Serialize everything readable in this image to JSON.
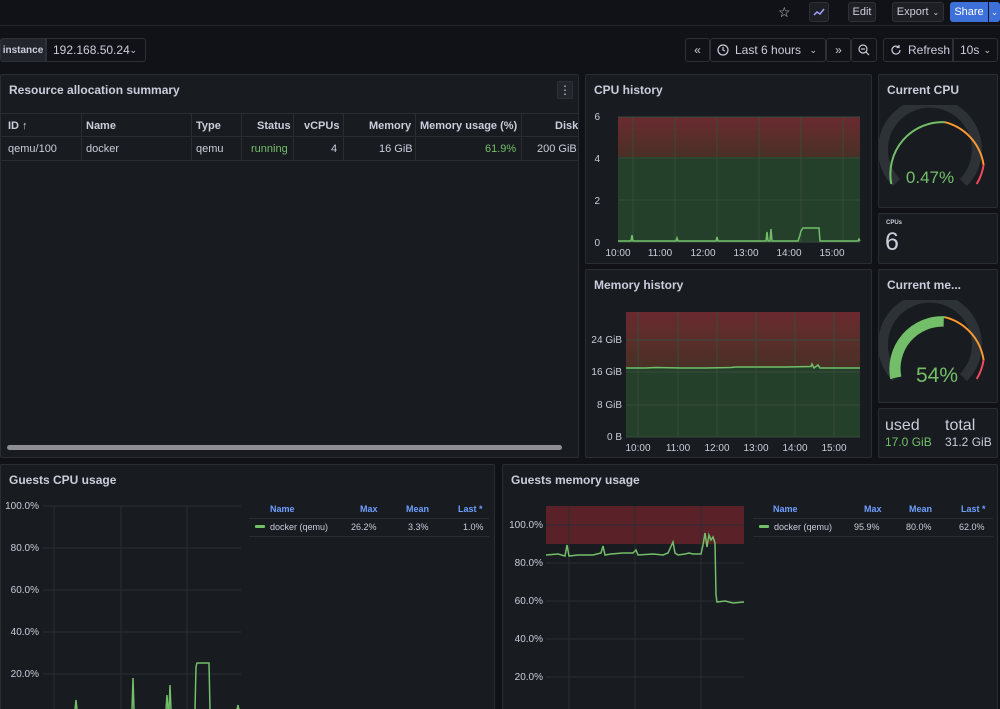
{
  "toolbar": {
    "edit": "Edit",
    "export": "Export",
    "share": "Share"
  },
  "controls": {
    "variable_label": "instance",
    "variable_value": "192.168.50.24",
    "time_range": "Last 6 hours",
    "refresh": "Refresh",
    "refresh_interval": "10s"
  },
  "resource_panel": {
    "title": "Resource allocation summary",
    "columns": [
      "ID ↑",
      "Name",
      "Type",
      "Status",
      "vCPUs",
      "Memory",
      "Memory usage (%)",
      "Disk"
    ],
    "rows": [
      {
        "id": "qemu/100",
        "name": "docker",
        "type": "qemu",
        "status": "running",
        "vcpus": "4",
        "memory": "16 GiB",
        "mem_usage": "61.9%",
        "disk": "200 GiB"
      }
    ]
  },
  "cpu_history": {
    "title": "CPU history",
    "yticks": [
      "6",
      "4",
      "2",
      "0"
    ],
    "xticks": [
      "10:00",
      "11:00",
      "12:00",
      "13:00",
      "14:00",
      "15:00"
    ]
  },
  "current_cpu": {
    "title": "Current CPU",
    "value": "0.47%",
    "fraction": 0.0047
  },
  "cpus_stat": {
    "label": "CPUs",
    "value": "6"
  },
  "memory_history": {
    "title": "Memory history",
    "yticks": [
      "24 GiB",
      "16 GiB",
      "8 GiB",
      "0 B"
    ],
    "xticks": [
      "10:00",
      "11:00",
      "12:00",
      "13:00",
      "14:00",
      "15:00"
    ]
  },
  "current_memory": {
    "title": "Current me...",
    "value": "54%",
    "fraction": 0.54
  },
  "memory_stat": {
    "used_label": "used",
    "used_value": "17.0 GiB",
    "total_label": "total",
    "total_value": "31.2 GiB"
  },
  "guests_cpu": {
    "title": "Guests CPU usage",
    "yticks": [
      "100.0%",
      "80.0%",
      "60.0%",
      "40.0%",
      "20.0%"
    ],
    "legend_headers": [
      "Name",
      "Max",
      "Mean",
      "Last *"
    ],
    "legend_row": {
      "name": "docker (qemu)",
      "max": "26.2%",
      "mean": "3.3%",
      "last": "1.0%"
    }
  },
  "guests_memory": {
    "title": "Guests memory usage",
    "yticks": [
      "100.0%",
      "80.0%",
      "60.0%",
      "40.0%",
      "20.0%"
    ],
    "legend_headers": [
      "Name",
      "Max",
      "Mean",
      "Last *"
    ],
    "legend_row": {
      "name": "docker (qemu)",
      "max": "95.9%",
      "mean": "80.0%",
      "last": "62.0%"
    }
  },
  "colors": {
    "series_green": "#73bf69",
    "threshold_red": "#e02f44",
    "gauge_track": "#2c3235",
    "accent_blue": "#3d71d9"
  },
  "icons": [
    "star-icon",
    "graph-icon",
    "chevron-down-icon",
    "clock-icon",
    "zoom-out-icon",
    "refresh-icon",
    "menu-dots-icon"
  ]
}
